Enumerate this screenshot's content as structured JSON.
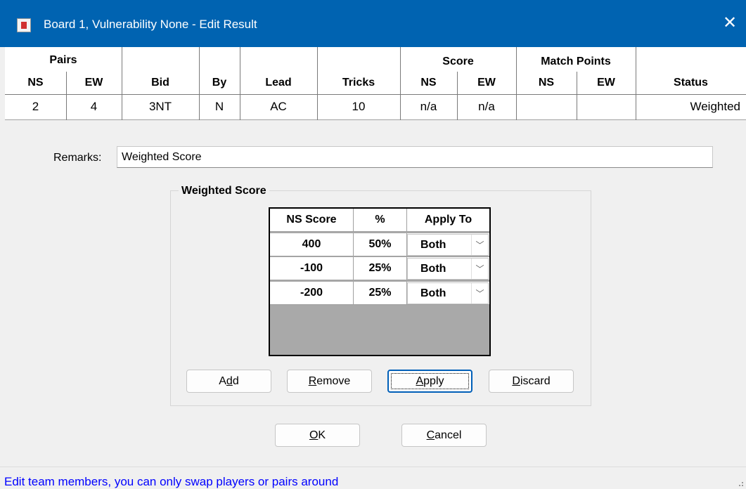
{
  "window": {
    "title": "Board 1,  Vulnerability None - Edit Result",
    "close_icon": "close-icon"
  },
  "result_table": {
    "group_headers": {
      "pairs": "Pairs",
      "score": "Score",
      "match_points": "Match Points"
    },
    "columns": {
      "ns": "NS",
      "ew": "EW",
      "bid": "Bid",
      "by": "By",
      "lead": "Lead",
      "tricks": "Tricks",
      "score_ns": "NS",
      "score_ew": "EW",
      "mp_ns": "NS",
      "mp_ew": "EW",
      "status": "Status"
    },
    "row": {
      "ns": "2",
      "ew": "4",
      "bid": "3NT",
      "by": "N",
      "lead": "AC",
      "tricks": "10",
      "score_ns": "n/a",
      "score_ew": "n/a",
      "mp_ns": "",
      "mp_ew": "",
      "status": "Weighted"
    }
  },
  "remarks": {
    "label": "Remarks:",
    "value": "Weighted Score"
  },
  "weighted": {
    "group_title": "Weighted Score",
    "headers": {
      "ns_score": "NS Score",
      "percent": "%",
      "apply_to": "Apply To"
    },
    "rows": [
      {
        "ns_score": "400",
        "percent": "50%",
        "apply_to": "Both"
      },
      {
        "ns_score": "-100",
        "percent": "25%",
        "apply_to": "Both"
      },
      {
        "ns_score": "-200",
        "percent": "25%",
        "apply_to": "Both"
      }
    ],
    "buttons": {
      "add": {
        "pre": "A",
        "ul": "d",
        "post": "d"
      },
      "remove": {
        "pre": "",
        "ul": "R",
        "post": "emove"
      },
      "apply": {
        "pre": "",
        "ul": "A",
        "post": "pply"
      },
      "discard": {
        "pre": "",
        "ul": "D",
        "post": "iscard"
      }
    }
  },
  "dialog_buttons": {
    "ok": {
      "pre": "",
      "ul": "O",
      "post": "K"
    },
    "cancel": {
      "pre": "",
      "ul": "C",
      "post": "ancel"
    }
  },
  "status_bar": {
    "text": "Edit team members, you can only swap players or pairs around"
  },
  "colors": {
    "titlebar": "#0063b1",
    "status_text": "#0000ff",
    "grid_empty": "#a9a9a9"
  }
}
